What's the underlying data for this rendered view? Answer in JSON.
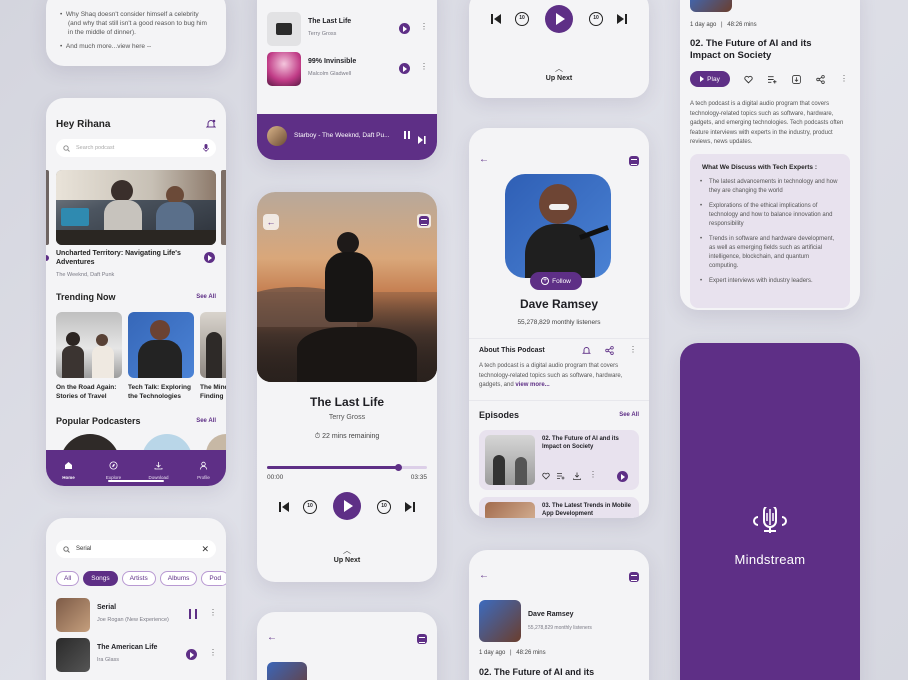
{
  "colors": {
    "accent": "#5e2f86",
    "accent_light": "#cdb8e0",
    "bg": "#f4f4f6"
  },
  "card1": {
    "lines": [
      "Why Shaq doesn't consider himself a celebrity",
      "(and why that still isn't a good reason to bug him",
      "in the middle of dinner)."
    ],
    "more": "And much more...view here --"
  },
  "home": {
    "greeting": "Hey Rihana",
    "search_placeholder": "Search podcast",
    "featured_title": "Uncharted Territory: Navigating Life's Adventures",
    "featured_artist": "The Weeknd, Daft Punk",
    "trending_title": "Trending Now",
    "see_all": "See All",
    "trending": [
      {
        "title": "On the Road Again: Stories of Travel"
      },
      {
        "title": "Tech Talk: Exploring the Technologies"
      },
      {
        "title": "The Mind Finding"
      }
    ],
    "popular_title": "Popular Podcasters",
    "nav": [
      "Home",
      "Explore",
      "Download",
      "Profile"
    ]
  },
  "search": {
    "query": "Serial",
    "filters": [
      "All",
      "Songs",
      "Artists",
      "Albums",
      "Pod"
    ],
    "results": [
      {
        "title": "Serial",
        "artist": "Joe Rogan (New Experience)"
      },
      {
        "title": "The American Life",
        "artist": "Ira Glass"
      }
    ]
  },
  "list": {
    "items": [
      {
        "title": "The Last Life",
        "artist": "Terry Gross"
      },
      {
        "title": "99% Invinsible",
        "artist": "Malcolm Gladwell"
      }
    ],
    "mini_player": "Starboy - The Weeknd, Daft Pu..."
  },
  "player": {
    "title": "The Last Life",
    "artist": "Terry Gross",
    "remaining": "22 mins remaining",
    "time_start": "00:00",
    "time_end": "03:35",
    "progress": 0.82,
    "up_next": "Up Next",
    "skip": "10"
  },
  "top_player": {
    "up_next": "Up Next",
    "skip": "10"
  },
  "artist": {
    "name": "Dave Ramsey",
    "listeners": "55,278,829 monthly listeners",
    "follow": "Follow",
    "about_title": "About This Podcast",
    "about_text": "A tech podcast is a digital audio program that covers technology-related topics such as software, hardware, gadgets, and",
    "view_more": "view more...",
    "episodes_title": "Episodes",
    "see_all": "See All",
    "episodes": [
      {
        "title": "02. The Future of AI and its Impact on Society"
      },
      {
        "title": "03. The Latest Trends in Mobile App Development"
      }
    ]
  },
  "episode_small": {
    "name": "Dave Ramsey",
    "listeners": "55,278,829 monthly listeners",
    "date": "1 day ago",
    "duration": "48:26 mins",
    "title": "02. The Future of AI and its"
  },
  "episode": {
    "date": "1 day ago",
    "duration": "48:26 mins",
    "title": "02. The Future of AI and its Impact on Society",
    "play": "Play",
    "desc": "A tech podcast is a digital audio program that covers technology-related topics such as software, hardware, gadgets, and emerging technologies. Tech podcasts often feature interviews with experts in the industry, product reviews, news updates.",
    "discuss_title": "What We Discuss with Tech Experts :",
    "bullets": [
      "The latest advancements in technology and how they are changing the world",
      "Explorations of the ethical implications of technology and how to balance innovation and responsibility",
      "Trends in software and hardware development, as well as emerging fields such as artificial intelligence, blockchain, and quantum computing.",
      "Expert interviews with industry leaders."
    ]
  },
  "splash": {
    "brand": "Mindstream"
  }
}
